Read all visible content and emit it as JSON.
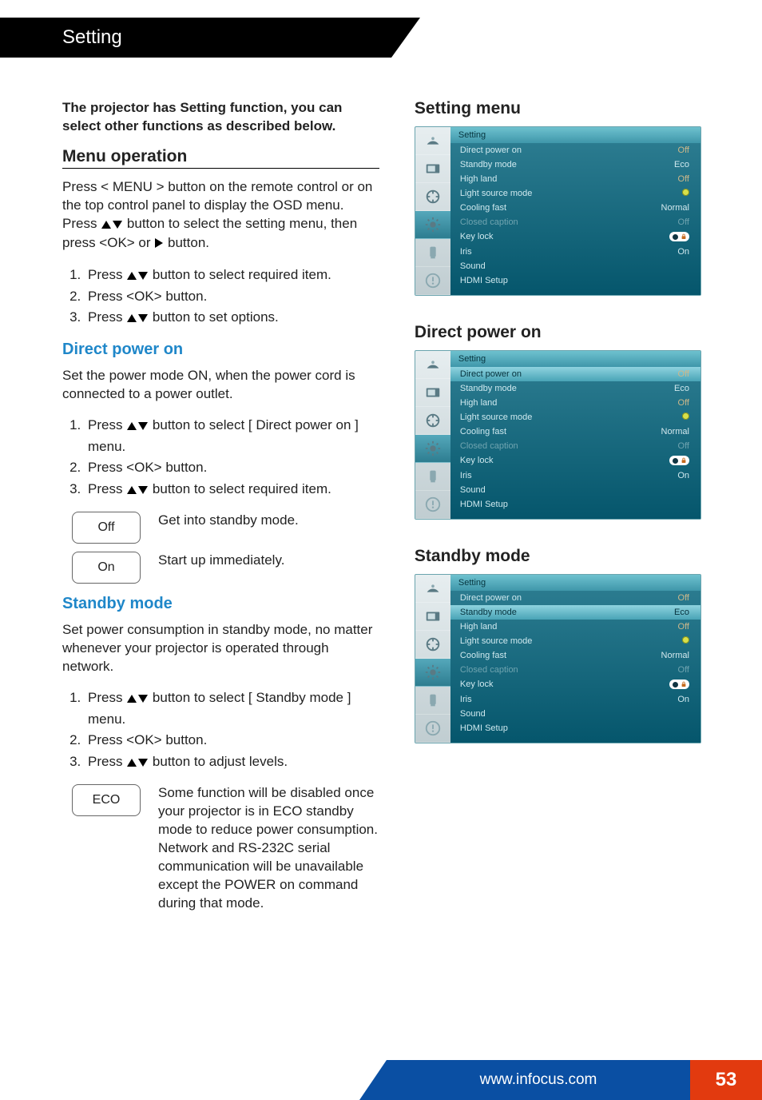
{
  "header": {
    "title": "Setting"
  },
  "intro": "The projector has Setting function, you can select other functions as described below.",
  "menu_op": {
    "title": "Menu operation",
    "para_a": "Press < MENU > button on the remote control or on the top control panel to display the OSD menu. Press ",
    "para_b": " button to select the setting menu, then press <OK> or ",
    "para_c": " button.",
    "step1a": "Press ",
    "step1b": " button to select required item.",
    "step2": "Press <OK> button.",
    "step3a": "Press ",
    "step3b": " button to set options."
  },
  "dpo": {
    "title": "Direct power on",
    "para": "Set the power mode ON, when the power cord is connected to a power outlet.",
    "step1a": "Press ",
    "step1b": " button to select [ Direct power on ] menu.",
    "step2": "Press <OK> button.",
    "step3a": "Press ",
    "step3b": " button to select required item.",
    "opt_off": "Off",
    "opt_off_desc": "Get into standby mode.",
    "opt_on": "On",
    "opt_on_desc": "Start up immediately."
  },
  "standby": {
    "title": "Standby mode",
    "para": "Set power consumption in standby mode, no matter whenever your projector is operated through network.",
    "step1a": "Press ",
    "step1b": " button to select [ Standby mode ] menu.",
    "step2": "Press <OK> button.",
    "step3a": "Press ",
    "step3b": " button to adjust levels.",
    "opt_eco": "ECO",
    "opt_eco_desc": "Some function will be disabled once your projector is in ECO standby mode to reduce power consumption. Network and RS-232C serial communication will be unavailable except the POWER on command during that mode."
  },
  "right": {
    "t1": "Setting menu",
    "t2": "Direct power on",
    "t3": "Standby mode"
  },
  "osd": {
    "title": "Setting",
    "rows": [
      {
        "l": "Direct power on",
        "v": "Off",
        "cls": "val-off"
      },
      {
        "l": "Standby mode",
        "v": "Eco",
        "cls": ""
      },
      {
        "l": "High land",
        "v": "Off",
        "cls": "val-off"
      },
      {
        "l": "Light source mode",
        "v": "@led",
        "cls": ""
      },
      {
        "l": "Cooling fast",
        "v": "Normal",
        "cls": "val-norm"
      },
      {
        "l": "Closed caption",
        "v": "Off",
        "cls": "",
        "disabled": true
      },
      {
        "l": "Key lock",
        "v": "@lock",
        "cls": ""
      },
      {
        "l": "Iris",
        "v": "On",
        "cls": ""
      },
      {
        "l": "Sound",
        "v": "",
        "cls": ""
      },
      {
        "l": "HDMI Setup",
        "v": "",
        "cls": ""
      }
    ]
  },
  "footer": {
    "url": "www.infocus.com",
    "page": "53"
  }
}
